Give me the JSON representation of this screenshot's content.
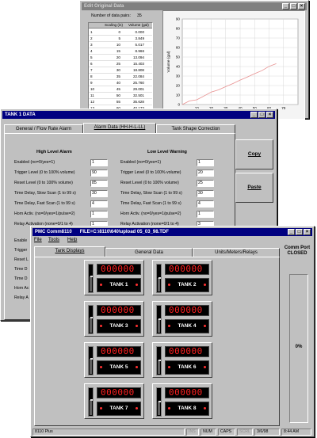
{
  "edit_window": {
    "title": "Edit Original Data",
    "points_label": "Number of data pairs:",
    "points_value": "35",
    "col_row": "",
    "col_scaling": "Scaling (in)",
    "col_volume": "Volume (gal)",
    "rows": [
      {
        "n": "1",
        "s": "0",
        "v": "0.000"
      },
      {
        "n": "2",
        "s": "5",
        "v": "3.849"
      },
      {
        "n": "3",
        "s": "10",
        "v": "5.017"
      },
      {
        "n": "4",
        "s": "15",
        "v": "8.966"
      },
      {
        "n": "5",
        "s": "20",
        "v": "13.094"
      },
      {
        "n": "6",
        "s": "25",
        "v": "15.403"
      },
      {
        "n": "7",
        "s": "30",
        "v": "18.808"
      },
      {
        "n": "8",
        "s": "35",
        "v": "22.084"
      },
      {
        "n": "9",
        "s": "40",
        "v": "25.760"
      },
      {
        "n": "10",
        "s": "45",
        "v": "29.001"
      },
      {
        "n": "11",
        "s": "50",
        "v": "32.501"
      },
      {
        "n": "12",
        "s": "55",
        "v": "35.628"
      },
      {
        "n": "13",
        "s": "60",
        "v": "40.173"
      },
      {
        "n": "14",
        "s": "65",
        "v": "43.004"
      }
    ],
    "chart": {
      "ylabel": "Volume (gal)",
      "yticks": [
        "90",
        "80",
        "70",
        "60",
        "50",
        "40",
        "30",
        "20",
        "10",
        "0"
      ],
      "xticks": [
        "10",
        "20",
        "30",
        "40",
        "50",
        "60",
        "70"
      ]
    }
  },
  "chart_data": {
    "type": "line",
    "title": "",
    "xlabel": "",
    "ylabel": "Volume (gal)",
    "xlim": [
      0,
      80
    ],
    "ylim": [
      0,
      90
    ],
    "grid": true,
    "series": [
      {
        "x": [
          0,
          5,
          10,
          15,
          20,
          25,
          30,
          35,
          40,
          45,
          50,
          55,
          60,
          65
        ],
        "y": [
          0,
          3.849,
          5.017,
          8.966,
          13.094,
          15.403,
          18.808,
          22.084,
          25.76,
          29.001,
          32.501,
          35.628,
          40.173,
          43.004
        ]
      }
    ],
    "line_color": "#e89090"
  },
  "tank_window": {
    "title": "TANK 1 DATA",
    "tabs": [
      "General / Flow Rate Alarm",
      "Alarm Data (HH-H-L-LL)",
      "Tank Shape Correction"
    ],
    "high_title": "High Level Alarm",
    "low_title": "Low Level Warning",
    "high_fields": [
      {
        "label": "Enabled (no=0/yes=1)",
        "value": "1"
      },
      {
        "label": "Trigger Level (0 to 100% volume)",
        "value": "90"
      },
      {
        "label": "Reset Level (0 to 100% volume)",
        "value": "85"
      },
      {
        "label": "Time Delay, Slow Scan (1 to 99 s)",
        "value": "30"
      },
      {
        "label": "Time Delay, Fast Scan (1 to 99 s)",
        "value": "4"
      },
      {
        "label": "Horn Activ. (no=0/yes=1/pulse=2)",
        "value": "1"
      },
      {
        "label": "Relay Activation (none=0/1 to 4)",
        "value": "1"
      }
    ],
    "low_fields": [
      {
        "label": "Enabled (no=0/yes=1)",
        "value": "1"
      },
      {
        "label": "Trigger Level (0 to 100% volume)",
        "value": "20"
      },
      {
        "label": "Reset Level (0 to 100% volume)",
        "value": "25"
      },
      {
        "label": "Time Delay, Slow Scan (1 to 99 s)",
        "value": "30"
      },
      {
        "label": "Time Delay, Fast Scan (1 to 99 s)",
        "value": "4"
      },
      {
        "label": "Horn Activ. (no=0/yes=1/pulse=2)",
        "value": "1"
      },
      {
        "label": "Relay Activation (none=0/1 to 4)",
        "value": "3"
      }
    ],
    "copy_label": "Copy",
    "paste_label": "Paste",
    "partial_labels": [
      "Enable",
      "Trigger",
      "Reset L",
      "Time D",
      "Time D",
      "Horn Ac",
      "Relay A"
    ]
  },
  "main_window": {
    "title": "PMC Comm8110",
    "file_path": "FILE=C:\\8110\\640\\upload 05_03_98.TDF",
    "menu": [
      "File",
      "Tools",
      "Help"
    ],
    "tabs": [
      "Tank Displays",
      "General Data",
      "Units/Meters/Relays"
    ],
    "comm_port": "Comm Port CLOSED",
    "gauge_value": "0%",
    "tanks": [
      {
        "display": "000000",
        "name": "TANK 1",
        "level": 0.55
      },
      {
        "display": "000000",
        "name": "TANK 2",
        "level": 0.5
      },
      {
        "display": "000000",
        "name": "TANK 3",
        "level": 0.55
      },
      {
        "display": "000000",
        "name": "TANK 4",
        "level": 0.5
      },
      {
        "display": "000000",
        "name": "TANK 5",
        "level": 0.55
      },
      {
        "display": "000000",
        "name": "TANK 6",
        "level": 0.5
      },
      {
        "display": "000000",
        "name": "TANK 7",
        "level": 0.55
      },
      {
        "display": "000000",
        "name": "TANK 8",
        "level": 0.5
      }
    ],
    "status": {
      "app": "8110 Plus",
      "ins": "INS",
      "num": "NUM",
      "caps": "CAPS",
      "scrl": "SCRL",
      "date": "3/6/98",
      "time": "8:44 AM"
    }
  }
}
